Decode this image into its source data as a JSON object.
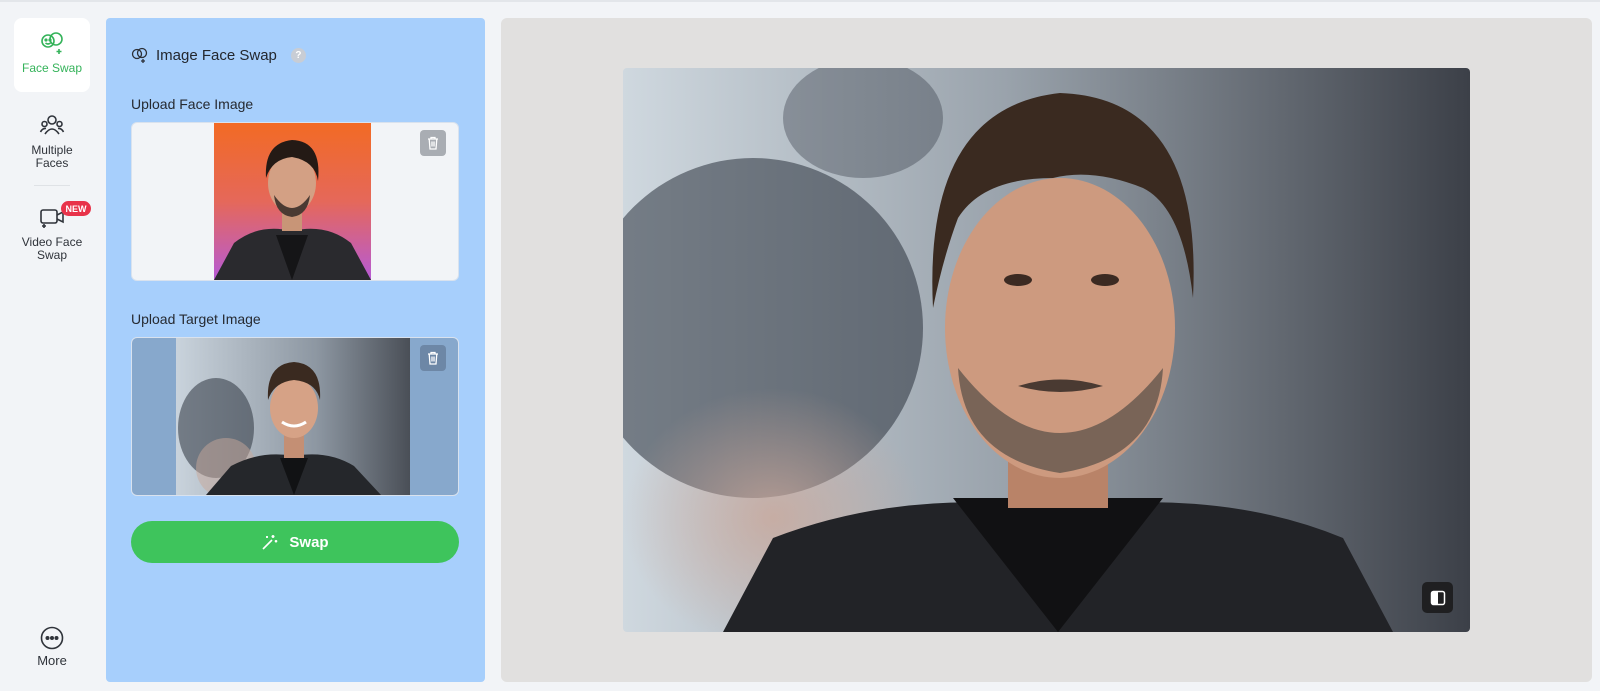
{
  "sidebar": {
    "items": [
      {
        "label": "Face Swap",
        "icon": "face-swap-icon",
        "active": true
      },
      {
        "label": "Multiple\nFaces",
        "icon": "multiple-faces-icon"
      },
      {
        "label": "Video Face\nSwap",
        "icon": "video-face-swap-icon",
        "badge": "NEW"
      }
    ],
    "more_label": "More",
    "more_icon": "more-dots-icon"
  },
  "panel": {
    "title": "Image Face Swap",
    "help_glyph": "?",
    "face_section_label": "Upload Face Image",
    "target_section_label": "Upload Target Image",
    "swap_label": "Swap"
  },
  "colors": {
    "accent_green": "#3ec45c",
    "panel_blue": "#a7cffc",
    "badge_red": "#e8334a"
  }
}
